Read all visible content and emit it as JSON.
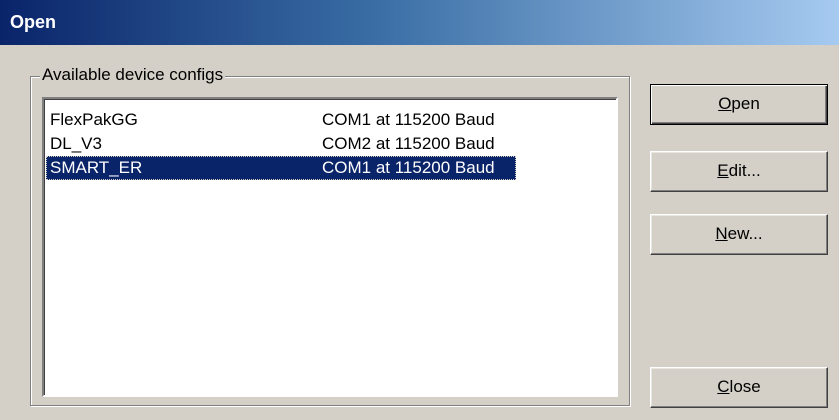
{
  "window": {
    "title": "Open"
  },
  "group": {
    "label": "Available device configs"
  },
  "list": {
    "items": [
      {
        "name": "FlexPakGG",
        "port": "COM1 at 115200 Baud",
        "selected": false
      },
      {
        "name": "DL_V3",
        "port": "COM2 at 115200 Baud",
        "selected": false
      },
      {
        "name": "SMART_ER",
        "port": "COM1 at 115200 Baud",
        "selected": true
      }
    ]
  },
  "buttons": {
    "open": {
      "accel": "O",
      "rest": "pen"
    },
    "edit": {
      "accel": "E",
      "rest": "dit..."
    },
    "new": {
      "accel": "N",
      "rest": "ew..."
    },
    "close": {
      "accel": "C",
      "rest": "lose"
    }
  },
  "colors": {
    "title_gradient_start": "#0a246a",
    "title_gradient_end": "#a6caf0",
    "selection": "#0a246a",
    "face": "#d4d0c8"
  }
}
